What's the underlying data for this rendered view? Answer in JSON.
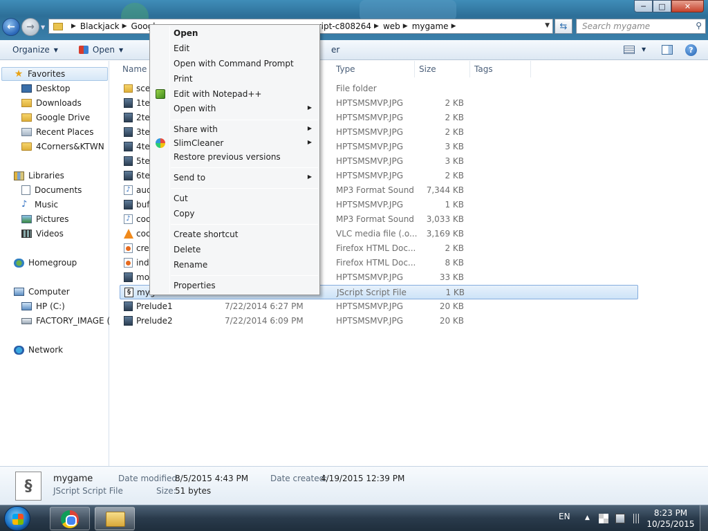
{
  "window": {
    "minimize_glyph": "─",
    "maximize_glyph": "□",
    "close_glyph": "✕"
  },
  "address": {
    "crumbs": [
      "Blackjack",
      "Googl",
      "escript-c808264",
      "web",
      "mygame"
    ],
    "search_placeholder": "Search mygame"
  },
  "toolbar": {
    "organize": "Organize",
    "open": "Open",
    "share": "Sh",
    "burn": "er"
  },
  "nav": {
    "favorites": "Favorites",
    "desktop": "Desktop",
    "downloads": "Downloads",
    "google_drive": "Google Drive",
    "recent_places": "Recent Places",
    "corners": "4Corners&KTWN",
    "libraries": "Libraries",
    "documents": "Documents",
    "music": "Music",
    "pictures": "Pictures",
    "videos": "Videos",
    "homegroup": "Homegroup",
    "computer": "Computer",
    "hp_c": "HP (C:)",
    "factory_image": "FACTORY_IMAGE (D",
    "network": "Network"
  },
  "columns": {
    "name": "Name",
    "type": "Type",
    "size": "Size",
    "tags": "Tags"
  },
  "files": [
    {
      "name": "sce",
      "date": "",
      "type": "File folder",
      "size": "",
      "icon": "folder"
    },
    {
      "name": "1te",
      "date": "",
      "type": "HPTSMSMVP.JPG",
      "size": "2 KB",
      "icon": "jpg"
    },
    {
      "name": "2te",
      "date": "",
      "type": "HPTSMSMVP.JPG",
      "size": "2 KB",
      "icon": "jpg"
    },
    {
      "name": "3te",
      "date": "",
      "type": "HPTSMSMVP.JPG",
      "size": "2 KB",
      "icon": "jpg"
    },
    {
      "name": "4te",
      "date": "",
      "type": "HPTSMSMVP.JPG",
      "size": "3 KB",
      "icon": "jpg"
    },
    {
      "name": "5te",
      "date": "",
      "type": "HPTSMSMVP.JPG",
      "size": "3 KB",
      "icon": "jpg"
    },
    {
      "name": "6te",
      "date": "",
      "type": "HPTSMSMVP.JPG",
      "size": "2 KB",
      "icon": "jpg"
    },
    {
      "name": "aud",
      "date": "",
      "type": "MP3 Format Sound",
      "size": "7,344 KB",
      "icon": "mp3"
    },
    {
      "name": "buf",
      "date": "",
      "type": "HPTSMSMVP.JPG",
      "size": "1 KB",
      "icon": "jpg"
    },
    {
      "name": "coo",
      "date": "",
      "type": "MP3 Format Sound",
      "size": "3,033 KB",
      "icon": "mp3"
    },
    {
      "name": "coo",
      "date": "",
      "type": "VLC media file (.o...",
      "size": "3,169 KB",
      "icon": "vlc"
    },
    {
      "name": "cre",
      "date": "",
      "type": "Firefox HTML Doc...",
      "size": "2 KB",
      "icon": "html"
    },
    {
      "name": "ind",
      "date": "",
      "type": "Firefox HTML Doc...",
      "size": "8 KB",
      "icon": "html"
    },
    {
      "name": "mo",
      "date": "",
      "type": "HPTSMSMVP.JPG",
      "size": "33 KB",
      "icon": "jpg"
    },
    {
      "name": "mygame",
      "date": "",
      "type": "JScript Script File",
      "size": "1 KB",
      "icon": "js"
    },
    {
      "name": "Prelude1",
      "date": "7/22/2014 6:27 PM",
      "type": "HPTSMSMVP.JPG",
      "size": "20 KB",
      "icon": "jpg"
    },
    {
      "name": "Prelude2",
      "date": "7/22/2014 6:09 PM",
      "type": "HPTSMSMVP.JPG",
      "size": "20 KB",
      "icon": "jpg"
    }
  ],
  "context_menu": {
    "open": "Open",
    "edit": "Edit",
    "open_cmd": "Open with Command Prompt",
    "print": "Print",
    "edit_npp": "Edit with Notepad++",
    "open_with": "Open with",
    "share_with": "Share with",
    "slimcleaner": "SlimCleaner",
    "restore": "Restore previous versions",
    "send_to": "Send to",
    "cut": "Cut",
    "copy": "Copy",
    "create_shortcut": "Create shortcut",
    "delete": "Delete",
    "rename": "Rename",
    "properties": "Properties"
  },
  "details": {
    "name": "mygame",
    "type": "JScript Script File",
    "modified_label": "Date modified:",
    "modified_value": "8/5/2015 4:43 PM",
    "created_label": "Date created:",
    "created_value": "4/19/2015 12:39 PM",
    "size_label": "Size:",
    "size_value": "51 bytes"
  },
  "taskbar": {
    "lang": "EN",
    "time": "8:23 PM",
    "date": "10/25/2015"
  }
}
